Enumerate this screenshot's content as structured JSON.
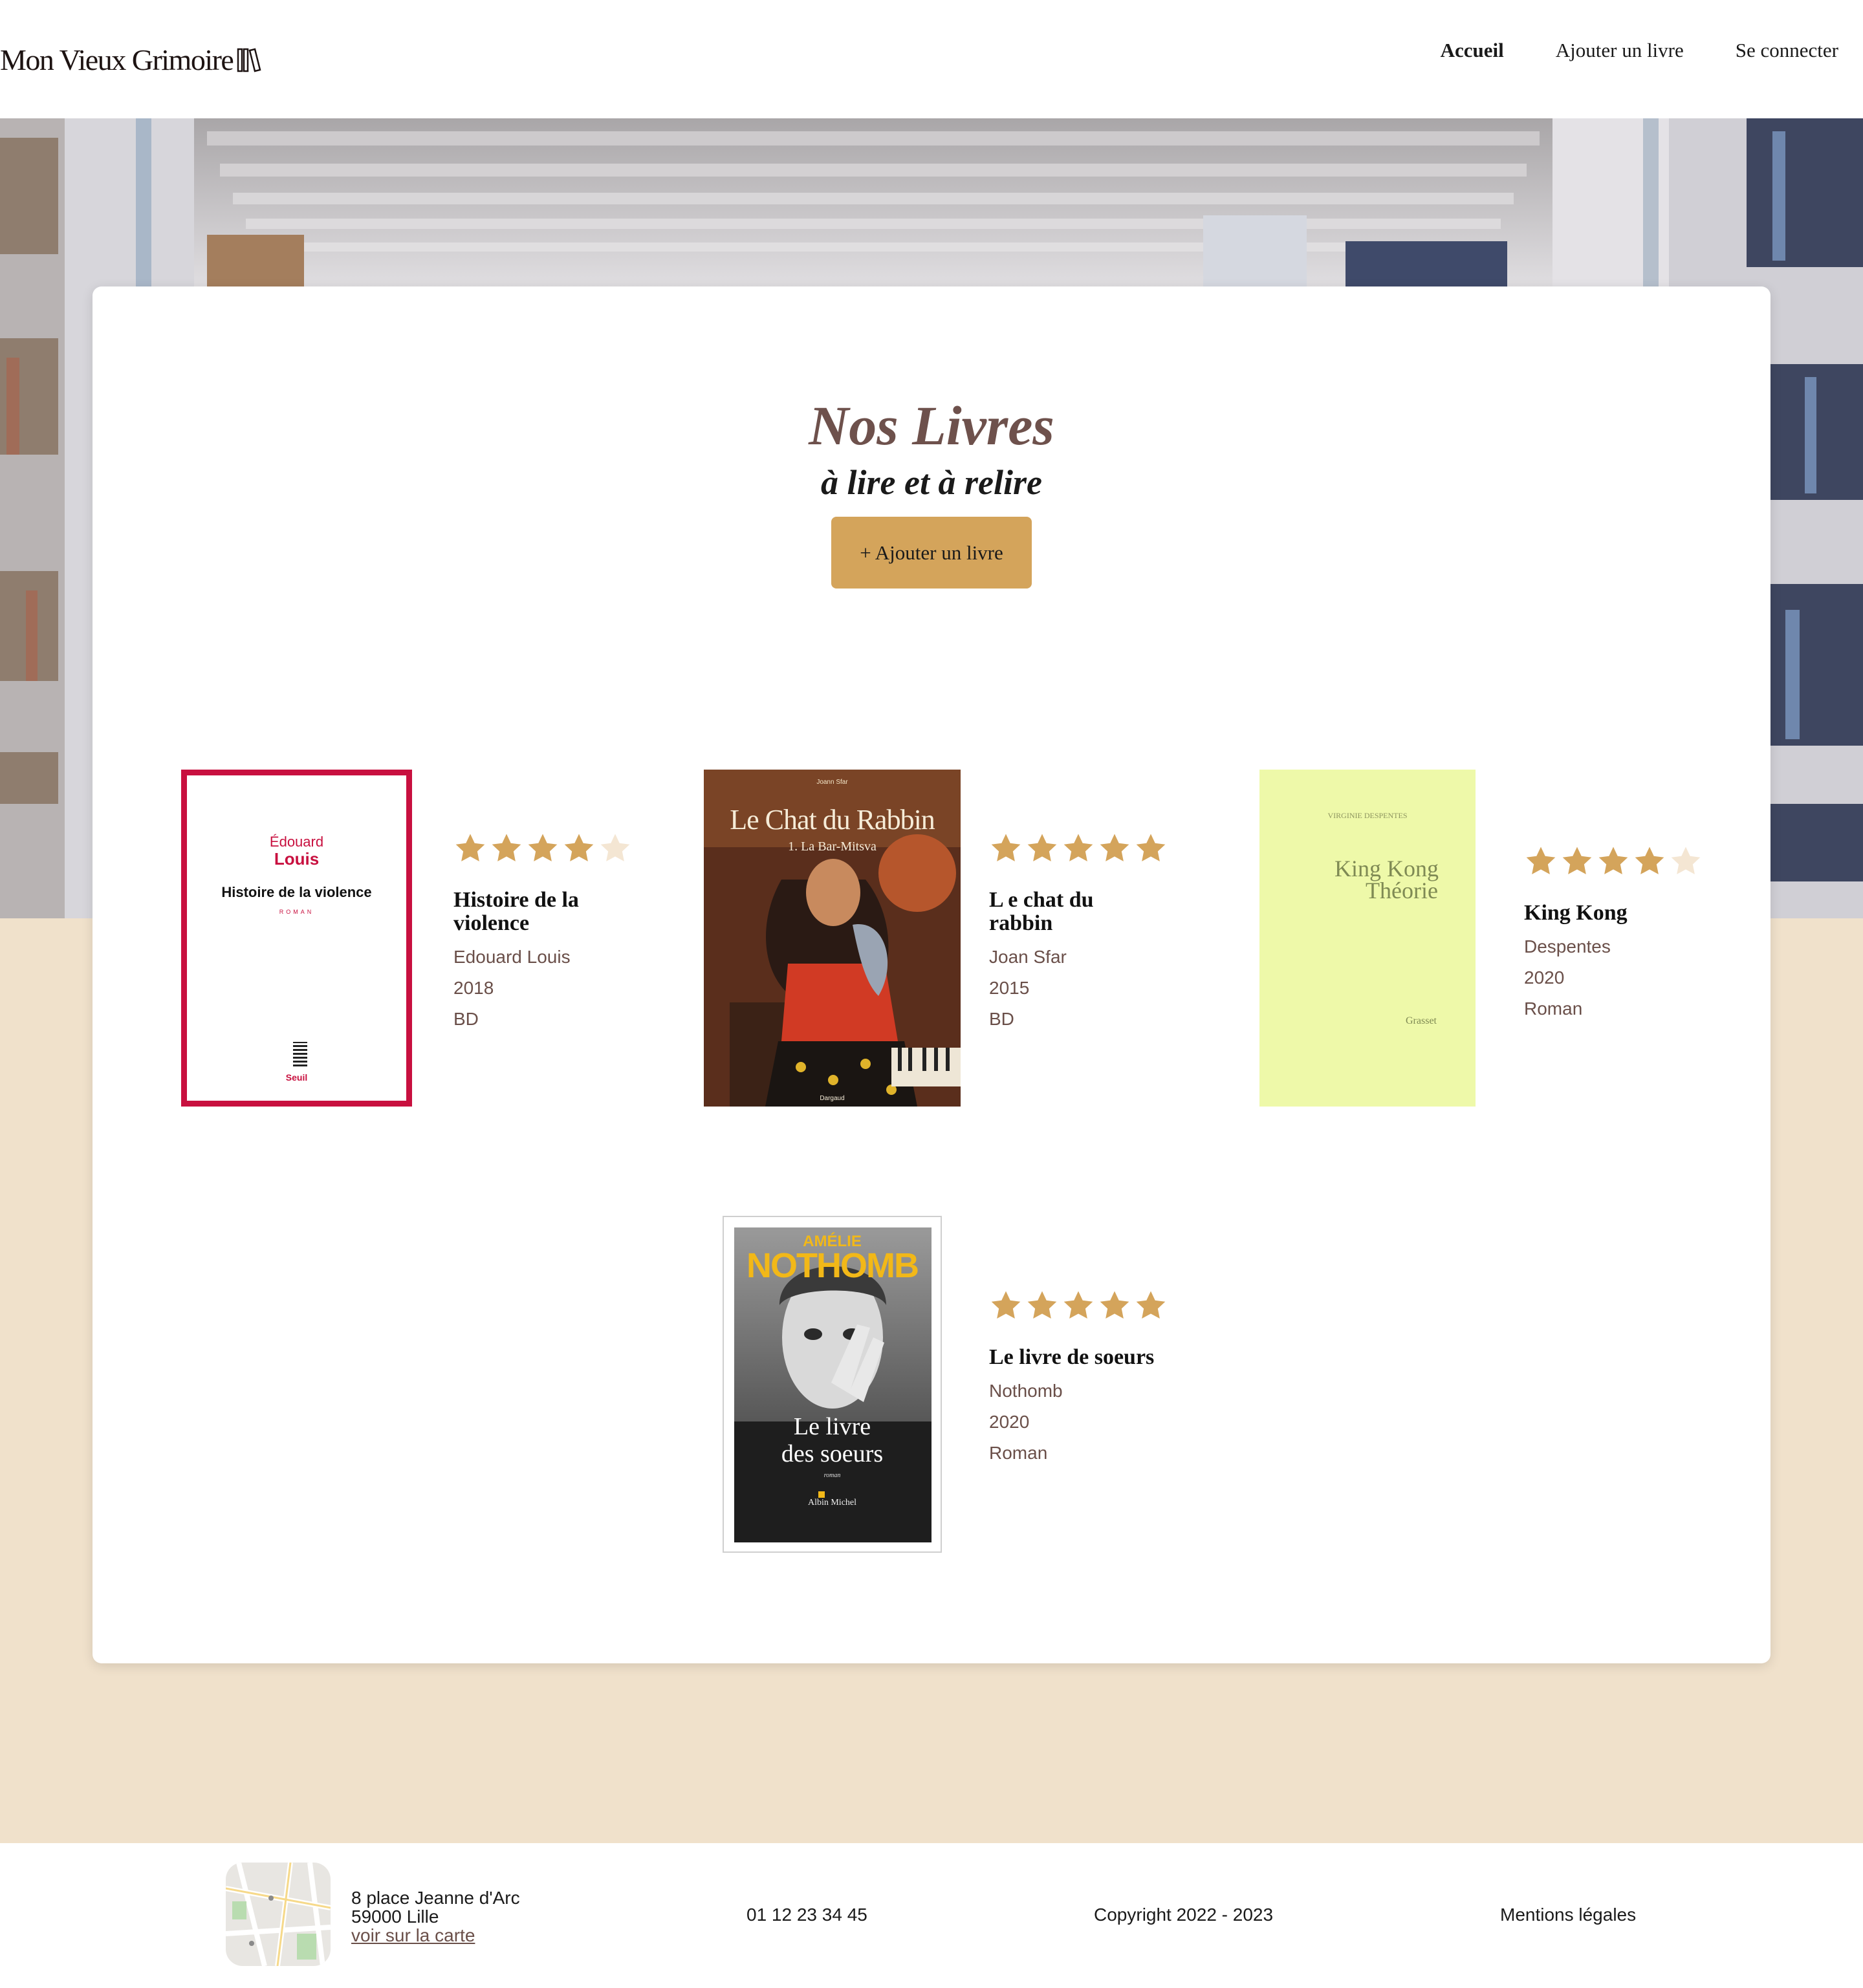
{
  "header": {
    "logo_text": "Mon Vieux Grimoire",
    "nav": [
      {
        "label": "Accueil",
        "active": true
      },
      {
        "label": "Ajouter un livre",
        "active": false
      },
      {
        "label": "Se connecter",
        "active": false
      }
    ]
  },
  "main": {
    "title": "Nos Livres",
    "subtitle": "à lire et à relire",
    "add_button": "+ Ajouter un livre"
  },
  "books": [
    {
      "title": "Histoire de la violence",
      "author": "Edouard Louis",
      "year": "2018",
      "genre": "BD",
      "rating": 4,
      "cover": {
        "author_first": "Édouard",
        "author_last": "Louis",
        "book_title": "Histoire de la violence",
        "label": "ROMAN",
        "publisher": "Seuil"
      }
    },
    {
      "title": "L e chat du rabbin",
      "author": "Joan Sfar",
      "year": "2015",
      "genre": "BD",
      "rating": 5,
      "cover": {
        "top": "Joann Sfar",
        "title": "Le Chat du Rabbin",
        "subtitle": "1. La Bar-Mitsva",
        "publisher": "Dargaud"
      }
    },
    {
      "title": "King Kong",
      "author": "Despentes",
      "year": "2020",
      "genre": "Roman",
      "rating": 4,
      "cover": {
        "author": "VIRGINIE DESPENTES",
        "line1": "King Kong",
        "line2": "Théorie",
        "publisher": "Grasset"
      }
    },
    {
      "title": "Le livre de soeurs",
      "author": "Nothomb",
      "year": "2020",
      "genre": "Roman",
      "rating": 5,
      "cover": {
        "author_first": "AMÉLIE",
        "author_last": "NOTHOMB",
        "line1": "Le livre",
        "line2": "des soeurs",
        "label": "roman",
        "publisher": "Albin Michel"
      }
    }
  ],
  "footer": {
    "address_line1": "8 place Jeanne d'Arc",
    "address_line2": "59000 Lille",
    "map_link": "voir sur la carte",
    "phone": "01 12 23 34 45",
    "copyright": "Copyright 2022 - 2023",
    "legal": "Mentions légales"
  },
  "colors": {
    "accent": "#d4a45b",
    "star_on": "#d4a45b",
    "star_off": "#f4e6d3",
    "title": "#6e514c",
    "meta": "#6a4f49",
    "page_bg": "#f0e1cb"
  }
}
